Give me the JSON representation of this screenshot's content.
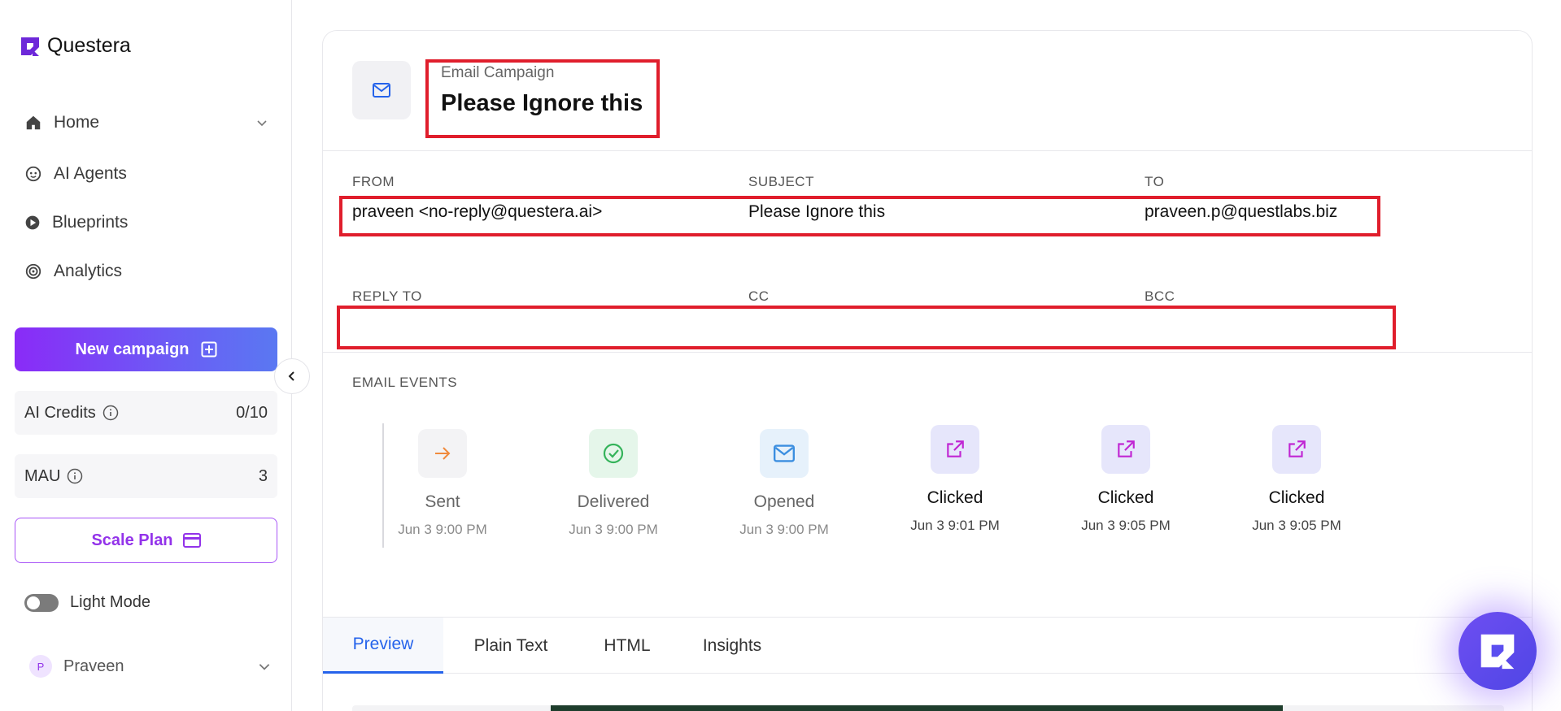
{
  "brand": {
    "name": "Questera"
  },
  "sidebar": {
    "items": [
      {
        "label": "Home",
        "icon": "home-icon"
      },
      {
        "label": "AI Agents",
        "icon": "agent-icon"
      },
      {
        "label": "Blueprints",
        "icon": "blueprint-icon"
      },
      {
        "label": "Analytics",
        "icon": "analytics-icon"
      }
    ],
    "new_campaign_label": "New campaign",
    "ai_credits": {
      "label": "AI Credits",
      "value": "0/10"
    },
    "mau": {
      "label": "MAU",
      "value": "3"
    },
    "scale_plan_label": "Scale Plan",
    "light_mode_label": "Light Mode",
    "user": {
      "initial": "P",
      "name": "Praveen"
    }
  },
  "header": {
    "eyebrow": "Email Campaign",
    "title": "Please Ignore this"
  },
  "fields": {
    "from": {
      "label": "FROM",
      "value": "praveen <no-reply@questera.ai>"
    },
    "subject": {
      "label": "SUBJECT",
      "value": "Please Ignore this"
    },
    "to": {
      "label": "TO",
      "value": "praveen.p@questlabs.biz"
    },
    "reply_to": {
      "label": "REPLY TO",
      "value": ""
    },
    "cc": {
      "label": "CC",
      "value": ""
    },
    "bcc": {
      "label": "BCC",
      "value": ""
    }
  },
  "events": {
    "label": "EMAIL EVENTS",
    "items": [
      {
        "name": "Sent",
        "time": "Jun 3 9:00 PM",
        "icon": "arrow-right-icon"
      },
      {
        "name": "Delivered",
        "time": "Jun 3 9:00 PM",
        "icon": "check-circle-icon"
      },
      {
        "name": "Opened",
        "time": "Jun 3 9:00 PM",
        "icon": "mail-icon"
      },
      {
        "name": "Clicked",
        "time": "Jun 3 9:01 PM",
        "icon": "external-link-icon"
      },
      {
        "name": "Clicked",
        "time": "Jun 3 9:05 PM",
        "icon": "external-link-icon"
      },
      {
        "name": "Clicked",
        "time": "Jun 3 9:05 PM",
        "icon": "external-link-icon"
      }
    ]
  },
  "tabs": [
    {
      "label": "Preview",
      "active": true
    },
    {
      "label": "Plain Text",
      "active": false
    },
    {
      "label": "HTML",
      "active": false
    },
    {
      "label": "Insights",
      "active": false
    }
  ],
  "colors": {
    "accent_purple": "#8a2bf7",
    "active_tab_blue": "#2563eb",
    "highlight_red": "#e01e2c"
  }
}
